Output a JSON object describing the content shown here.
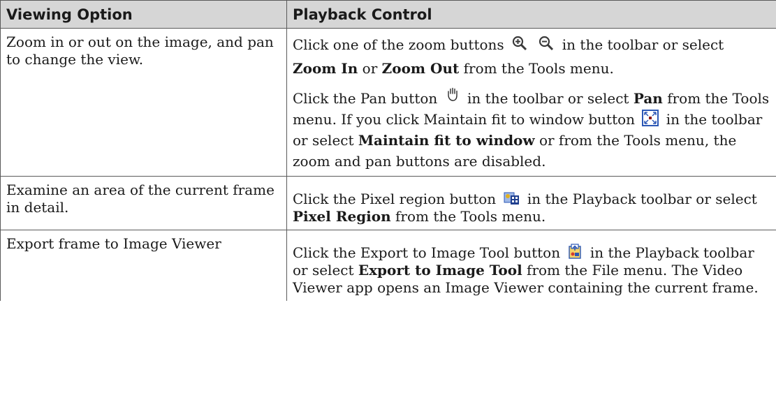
{
  "table": {
    "headers": [
      "Viewing Option",
      "Playback Control"
    ],
    "rows": [
      {
        "option": "Zoom in or out on the image, and pan to change the view.",
        "para1": {
          "t1": "Click one of the zoom buttons",
          "t2": "in the toolbar or select",
          "b1": "Zoom In",
          "t3": "or",
          "b2": "Zoom Out",
          "t4": "from the Tools menu."
        },
        "para2": {
          "t1": "Click the Pan button",
          "t2": "in the toolbar or select",
          "b1": "Pan",
          "t3": "from the Tools menu. If you click Maintain fit to window button",
          "t4": "in the toolbar or select",
          "b2": "Maintain fit to window",
          "t5": "or from the Tools menu, the zoom and pan buttons are disabled."
        }
      },
      {
        "option": "Examine an area of the current frame in detail.",
        "para1": {
          "t1": "Click the Pixel region button",
          "t2": "in the Playback toolbar or select",
          "b1": "Pixel Region",
          "t3": "from the Tools menu."
        }
      },
      {
        "option": "Export frame to Image Viewer",
        "para1": {
          "t1": "Click the Export to Image Tool button",
          "t2": "in the Playback toolbar or select",
          "b1": "Export to Image Tool",
          "t3": "from the File menu. The Video Viewer app opens an Image Viewer containing the current frame."
        }
      }
    ]
  },
  "icons": [
    "zoom-in-icon",
    "zoom-out-icon",
    "pan-hand-icon",
    "maintain-fit-icon",
    "pixel-region-icon",
    "export-image-icon"
  ],
  "colors": {
    "header_bg": "#d6d6d6",
    "border": "#5a5a5a",
    "icon_blue": "#2b57b5"
  }
}
